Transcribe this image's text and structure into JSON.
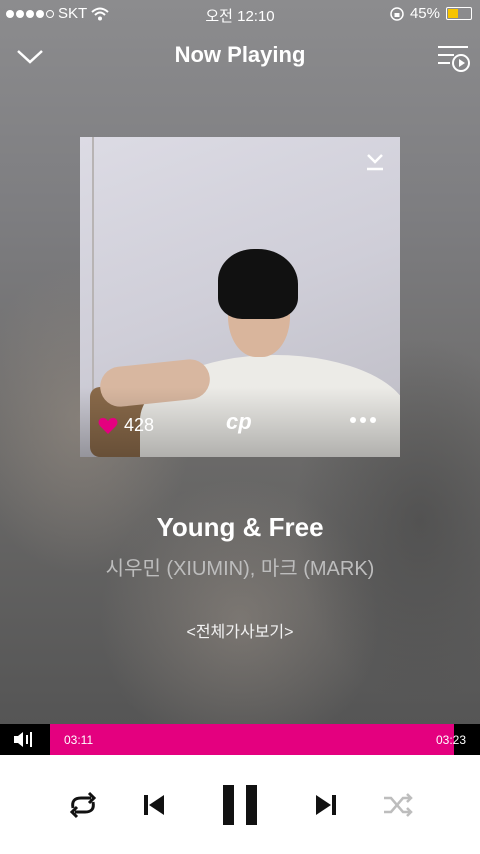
{
  "status_bar": {
    "carrier": "SKT",
    "time": "오전 12:10",
    "battery_percent": "45%",
    "battery_level": 0.45
  },
  "header": {
    "title": "Now Playing",
    "collapse_icon": "chevron-down-icon",
    "playlist_icon": "playlist-play-icon"
  },
  "album": {
    "likes": "428",
    "logo": "cp",
    "download_icon": "download-icon",
    "more_icon": "more-dots-icon"
  },
  "track": {
    "title": "Young & Free",
    "artist": "시우민 (XIUMIN), 마크 (MARK)",
    "lyrics_link": "<전체가사보기>"
  },
  "progress": {
    "elapsed": "03:11",
    "total": "03:23",
    "fraction": 0.94,
    "color": "#e4007f"
  },
  "controls": {
    "repeat_icon": "repeat-icon",
    "prev_icon": "skip-previous-icon",
    "pause_icon": "pause-icon",
    "next_icon": "skip-next-icon",
    "shuffle_icon": "shuffle-icon"
  }
}
